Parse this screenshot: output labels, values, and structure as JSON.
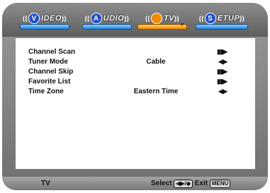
{
  "tabs": [
    {
      "icon_letter": "V",
      "label": "IDEO",
      "color": "#1f4fc9",
      "active": false
    },
    {
      "icon_letter": "A",
      "label": "UDIO",
      "color": "#1f4fc9",
      "active": false
    },
    {
      "icon_letter": "●",
      "label": "TV",
      "color": "#f08a00",
      "active": true
    },
    {
      "icon_letter": "S",
      "label": "ETUP",
      "color": "#1f4fc9",
      "active": false
    }
  ],
  "wave_left": "((",
  "wave_right": "))",
  "menu": [
    {
      "label": "Channel Scan",
      "value": "",
      "arrow": "▮▮▶"
    },
    {
      "label": "Tuner Mode",
      "value": "Cable",
      "arrow": "◀▶"
    },
    {
      "label": "Channel Skip",
      "value": "",
      "arrow": "▮▮▶"
    },
    {
      "label": "Favorite List",
      "value": "",
      "arrow": "▮▮▶"
    },
    {
      "label": "Time Zone",
      "value": "Eastern Time",
      "arrow": "◀▶"
    }
  ],
  "footer": {
    "source": "TV",
    "select_label": "Select",
    "select_key": "◀▶/◆",
    "exit_label": "Exit",
    "exit_key": "MENU"
  }
}
